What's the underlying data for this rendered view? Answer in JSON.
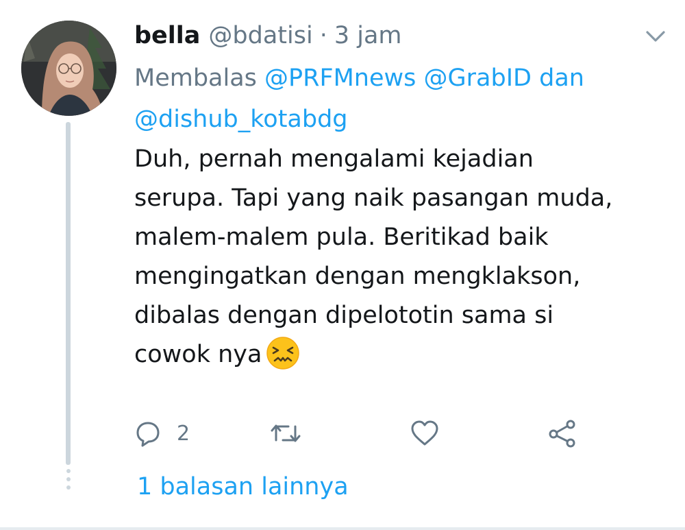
{
  "tweet": {
    "author_name": "bella",
    "author_handle": "@bdatisi",
    "separator": "·",
    "time": "3 jam",
    "replying_prefix": "Membalas",
    "replying_to": [
      "@PRFMnews",
      "@GrabID"
    ],
    "replying_joiner": "dan",
    "replying_last": "@dishub_kotabdg",
    "text_lines": [
      "Duh, pernah mengalami kejadian",
      "serupa. Tapi yang naik pasangan muda,",
      "malem-malem pula. Beritikad baik",
      "mengingatkan dengan mengklakson,",
      "dibalas dengan dipelototin sama si",
      "cowok nya"
    ],
    "emoji": "confounded-face-emoji",
    "reply_count": "2",
    "more_replies_label": "1 balasan lainnya"
  },
  "icons": {
    "menu": "chevron-down-icon",
    "reply": "reply-icon",
    "retweet": "retweet-icon",
    "like": "heart-icon",
    "share": "share-icon"
  },
  "colors": {
    "text": "#14171a",
    "secondary": "#657786",
    "link": "#1da1f2",
    "thread_line": "#ccd6dd",
    "background": "#ffffff"
  }
}
